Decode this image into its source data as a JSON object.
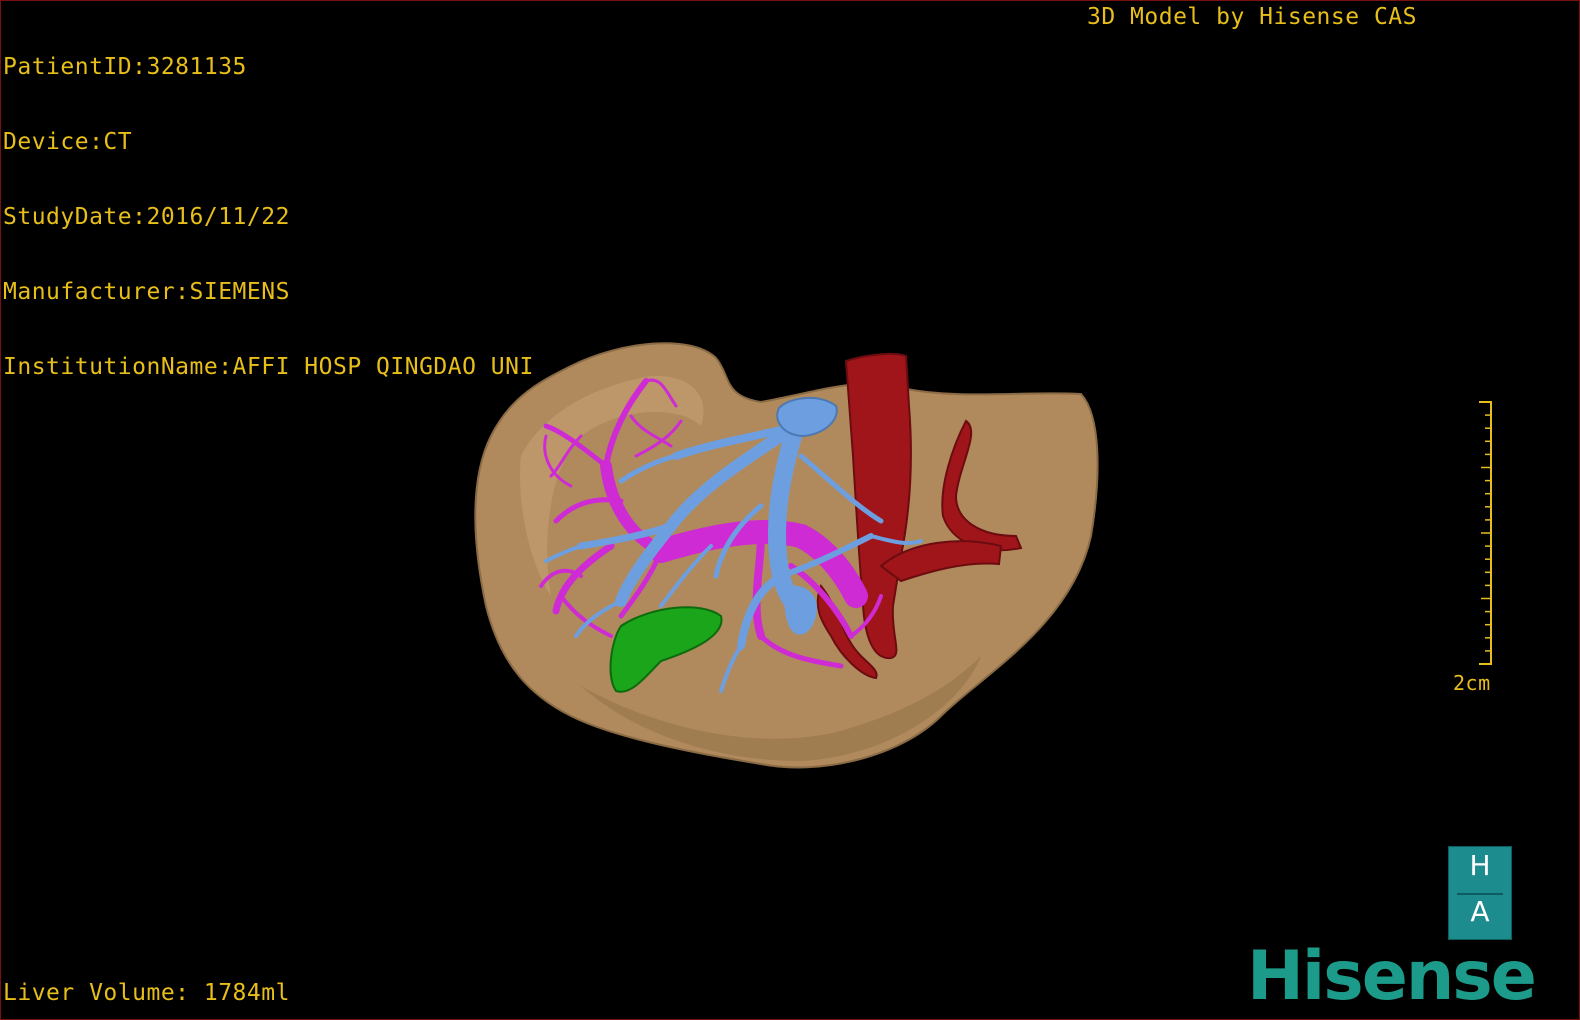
{
  "info": {
    "lines": [
      "PatientID:3281135",
      "Device:CT",
      "StudyDate:2016/11/22",
      "Manufacturer:SIEMENS",
      "InstitutionName:AFFI HOSP QINGDAO UNI"
    ]
  },
  "credit": "3D Model by Hisense CAS",
  "volume": "Liver Volume: 1784ml",
  "scale": {
    "label": "2cm"
  },
  "orientation": {
    "top": "H",
    "bottom": "A"
  },
  "brand": {
    "logo_text": "Hisense"
  },
  "colors": {
    "overlay_text": "#e8bf1a",
    "liver": "#b08a5c",
    "portal_vein": "#cf2bd4",
    "hepatic_vein": "#6d9fe0",
    "artery_ivc": "#a0151a",
    "gallbladder": "#1ba51b",
    "brand": "#1c9b8a"
  },
  "icons": [
    "orientation-cube-icon",
    "hisense-logo"
  ]
}
